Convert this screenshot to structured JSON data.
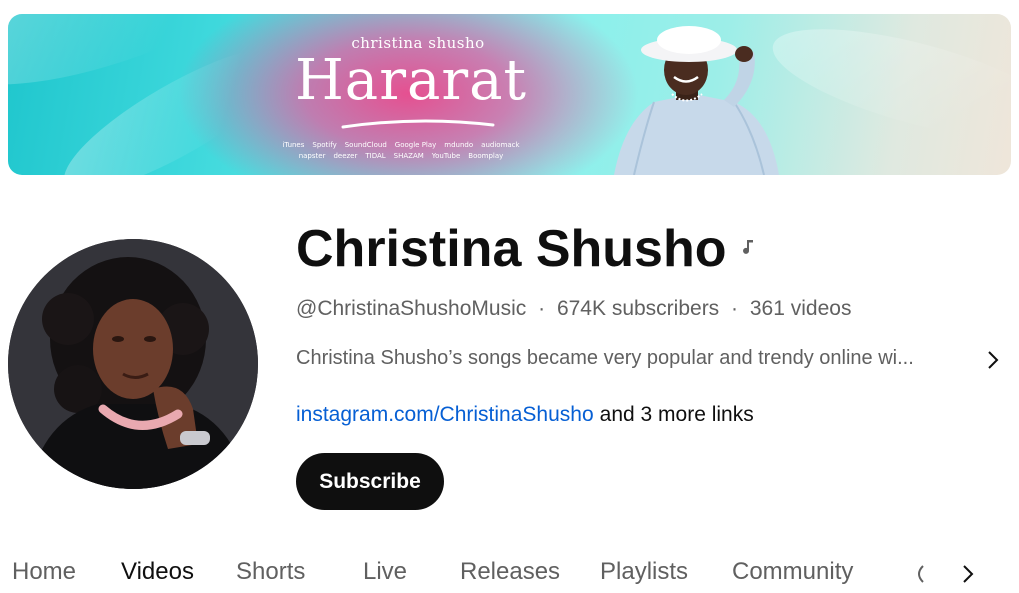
{
  "banner": {
    "tagline": "christina shusho",
    "title": "Hararat",
    "platforms": [
      "iTunes",
      "Spotify",
      "SoundCloud",
      "Google Play",
      "mdundo",
      "audiomack",
      "napster",
      "deezer",
      "TIDAL",
      "SHAZAM",
      "YouTube",
      "Boomplay"
    ]
  },
  "channel": {
    "name": "Christina Shusho",
    "handle": "@ChristinaShushoMusic",
    "subscribers": "674K subscribers",
    "videos": "361 videos",
    "separator": "·",
    "description": "Christina Shusho’s songs became very popular and trendy online wi...",
    "link_text": "instagram.com/ChristinaShusho",
    "more_links": "and 3 more links",
    "subscribe_label": "Subscribe"
  },
  "tabs": [
    {
      "label": "Home"
    },
    {
      "label": "Videos"
    },
    {
      "label": "Shorts"
    },
    {
      "label": "Live"
    },
    {
      "label": "Releases"
    },
    {
      "label": "Playlists"
    },
    {
      "label": "Community"
    }
  ],
  "active_tab": "Videos",
  "icons": {
    "channel_badge": "music-note-icon",
    "description_expand": "chevron-right-icon",
    "tabs_prev": "chevron-left-icon",
    "tabs_next": "chevron-right-icon"
  },
  "colors": {
    "text_primary": "#0f0f0f",
    "text_secondary": "#606060",
    "link": "#065fd4",
    "subscribe_bg": "#0f0f0f",
    "subscribe_text": "#ffffff",
    "banner_teal": "#3ed8dc",
    "banner_pink": "#e25ca0"
  }
}
